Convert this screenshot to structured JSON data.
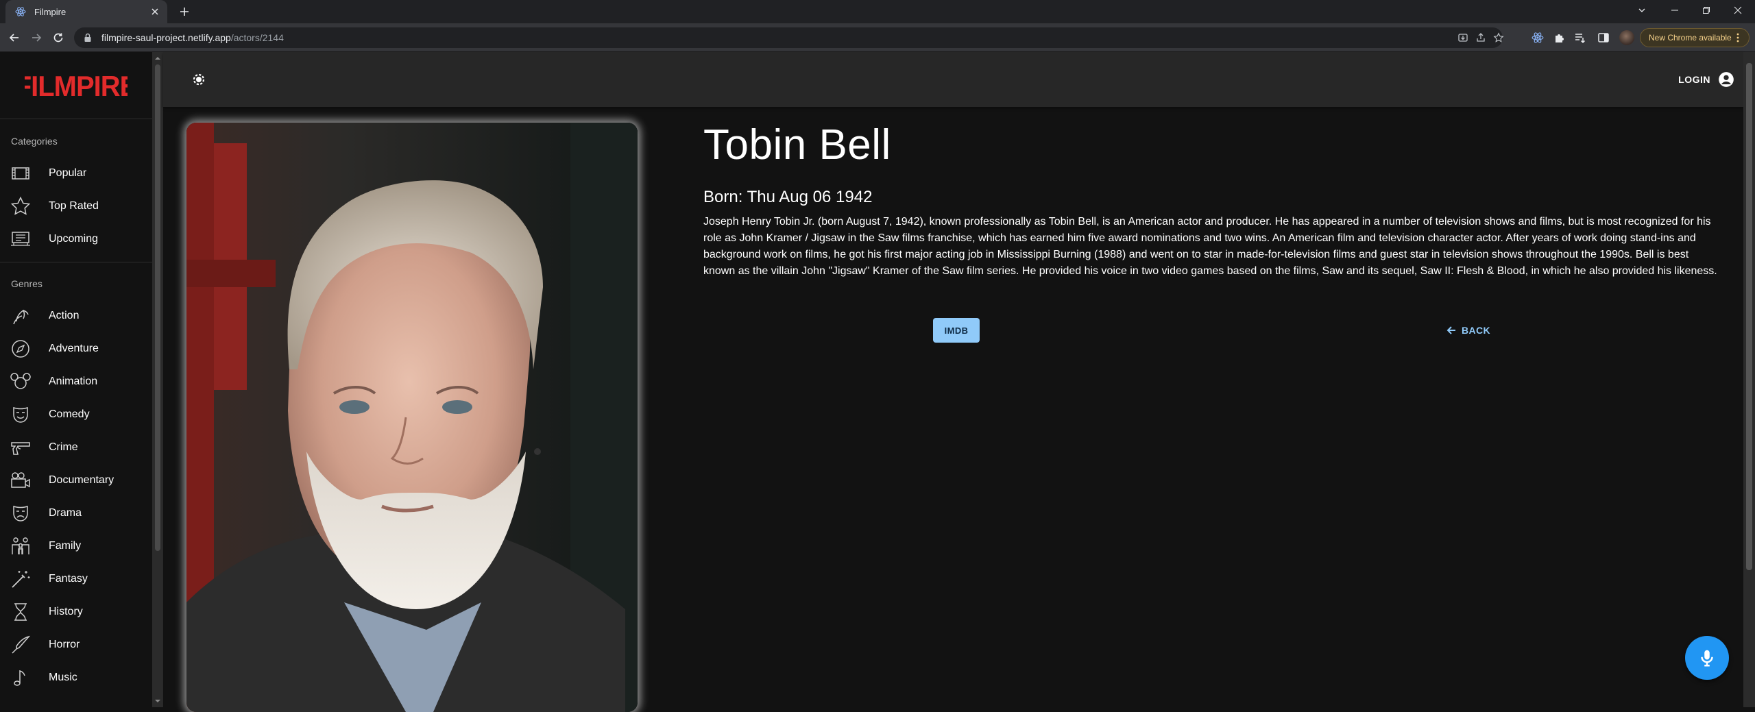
{
  "browser": {
    "tab_title": "Filmpire",
    "url_host": "filmpire-saul-project.netlify.app",
    "url_path": "/actors/2144",
    "update_label": "New Chrome available"
  },
  "sidebar": {
    "logo_text": "FILMPIRE",
    "categories_title": "Categories",
    "categories": [
      {
        "label": "Popular",
        "icon": "popular-icon"
      },
      {
        "label": "Top Rated",
        "icon": "star-icon"
      },
      {
        "label": "Upcoming",
        "icon": "upcoming-icon"
      }
    ],
    "genres_title": "Genres",
    "genres": [
      {
        "label": "Action",
        "icon": "action-icon"
      },
      {
        "label": "Adventure",
        "icon": "compass-icon"
      },
      {
        "label": "Animation",
        "icon": "animation-icon"
      },
      {
        "label": "Comedy",
        "icon": "comedy-mask-icon"
      },
      {
        "label": "Crime",
        "icon": "gun-icon"
      },
      {
        "label": "Documentary",
        "icon": "camera-icon"
      },
      {
        "label": "Drama",
        "icon": "drama-mask-icon"
      },
      {
        "label": "Family",
        "icon": "family-icon"
      },
      {
        "label": "Fantasy",
        "icon": "magic-wand-icon"
      },
      {
        "label": "History",
        "icon": "hourglass-icon"
      },
      {
        "label": "Horror",
        "icon": "knife-icon"
      },
      {
        "label": "Music",
        "icon": "music-note-icon"
      }
    ]
  },
  "header": {
    "login_label": "LOGIN"
  },
  "actor": {
    "name": "Tobin Bell",
    "born": "Born: Thu Aug 06 1942",
    "biography": "Joseph Henry Tobin Jr. (born August 7, 1942), known professionally as Tobin Bell, is an American actor and producer. He has appeared in a number of television shows and films, but is most recognized for his role as John Kramer / Jigsaw in the Saw films franchise, which has earned him five award nominations and two wins. An American film and television character actor. After years of work doing stand-ins and background work on films, he got his first major acting job in Mississippi Burning (1988) and went on to star in made-for-television films and guest star in television shows throughout the 1990s. Bell is best known as the villain John \"Jigsaw\" Kramer of the Saw film series. He provided his voice in two video games based on the films, Saw and its sequel, Saw II: Flesh & Blood, in which he also provided his likeness.",
    "imdb_label": "IMDB",
    "back_label": "BACK"
  },
  "colors": {
    "brand_red": "#e22b2b",
    "accent_blue": "#90caf9",
    "fab_blue": "#2196f3"
  }
}
